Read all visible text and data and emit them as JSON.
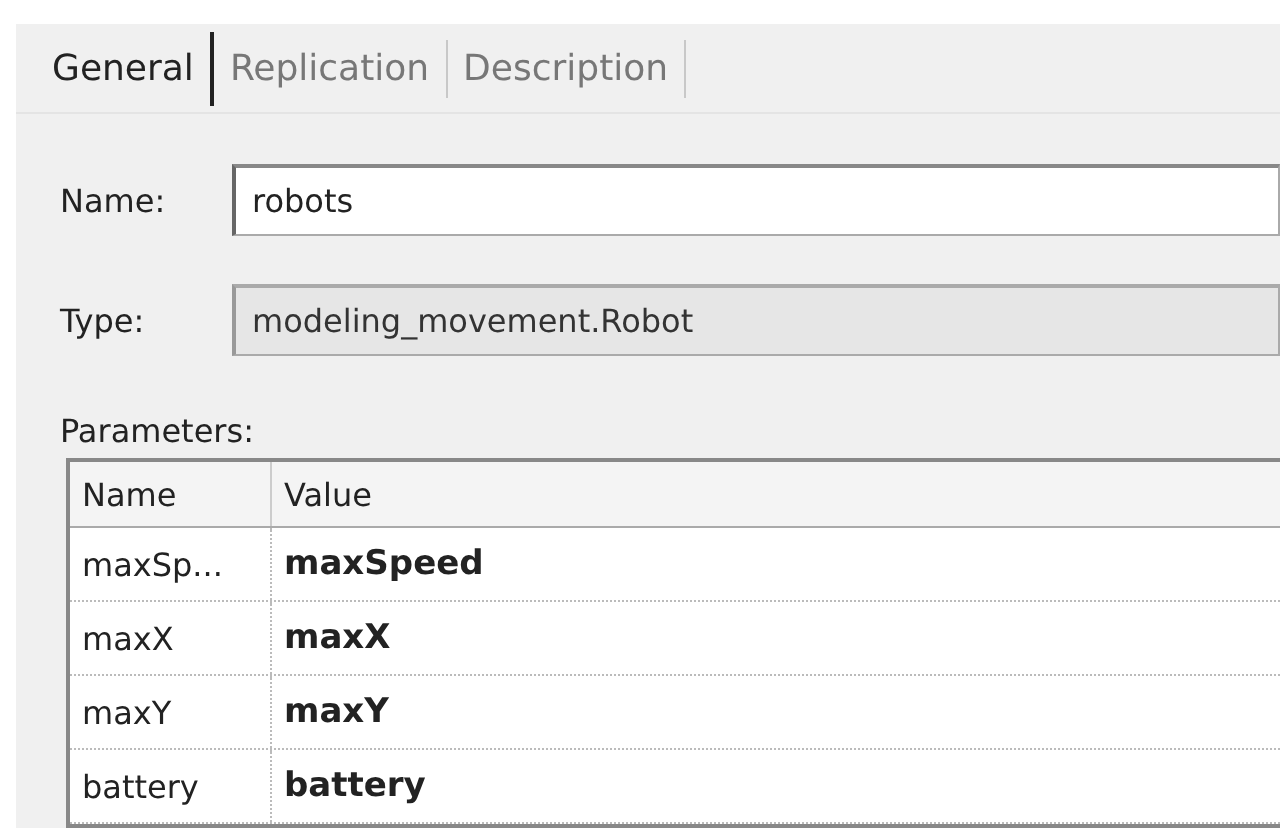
{
  "tabs": [
    {
      "label": "General",
      "selected": true
    },
    {
      "label": "Replication",
      "selected": false
    },
    {
      "label": "Description",
      "selected": false
    }
  ],
  "fields": [
    {
      "label": "Name:",
      "value": "robots",
      "disabled": false
    },
    {
      "label": "Type:",
      "value": "modeling_movement.Robot",
      "disabled": true
    }
  ],
  "parameters": {
    "label": "Parameters:",
    "columns": [
      "Name",
      "Value"
    ],
    "rows": [
      {
        "name": "maxSp...",
        "value": "maxSpeed"
      },
      {
        "name": "maxX",
        "value": "maxX"
      },
      {
        "name": "maxY",
        "value": "maxY"
      },
      {
        "name": "battery",
        "value": "battery"
      }
    ]
  }
}
